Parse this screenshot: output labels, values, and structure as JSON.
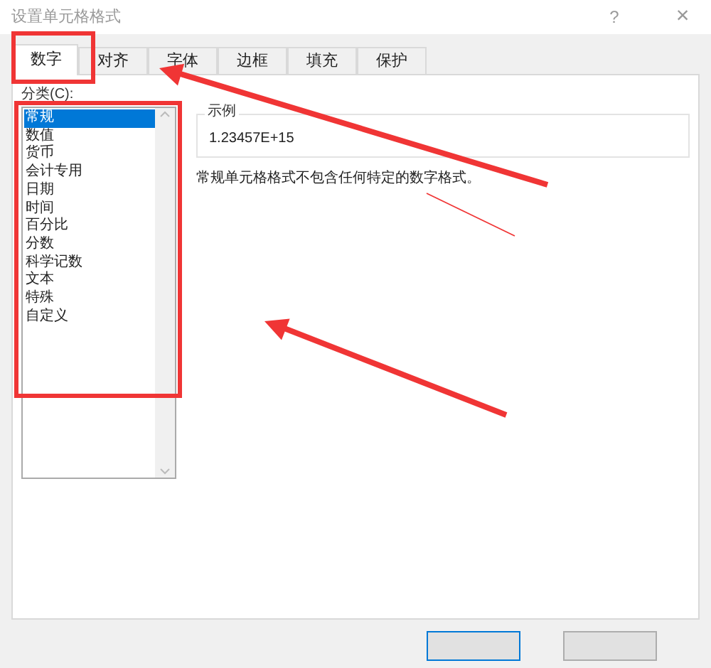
{
  "window": {
    "title": "设置单元格格式",
    "help": "?",
    "close": "×"
  },
  "tabs": [
    {
      "label": "数字",
      "selected": true
    },
    {
      "label": "对齐",
      "selected": false
    },
    {
      "label": "字体",
      "selected": false
    },
    {
      "label": "边框",
      "selected": false
    },
    {
      "label": "填充",
      "selected": false
    },
    {
      "label": "保护",
      "selected": false
    }
  ],
  "category": {
    "label": "分类(C):",
    "items": [
      {
        "label": "常规",
        "selected": true
      },
      {
        "label": "数值",
        "selected": false
      },
      {
        "label": "货币",
        "selected": false
      },
      {
        "label": "会计专用",
        "selected": false
      },
      {
        "label": "日期",
        "selected": false
      },
      {
        "label": "时间",
        "selected": false
      },
      {
        "label": "百分比",
        "selected": false
      },
      {
        "label": "分数",
        "selected": false
      },
      {
        "label": "科学记数",
        "selected": false
      },
      {
        "label": "文本",
        "selected": false
      },
      {
        "label": "特殊",
        "selected": false
      },
      {
        "label": "自定义",
        "selected": false
      }
    ]
  },
  "sample": {
    "legend": "示例",
    "value": "1.23457E+15"
  },
  "description": "常规单元格格式不包含任何特定的数字格式。"
}
